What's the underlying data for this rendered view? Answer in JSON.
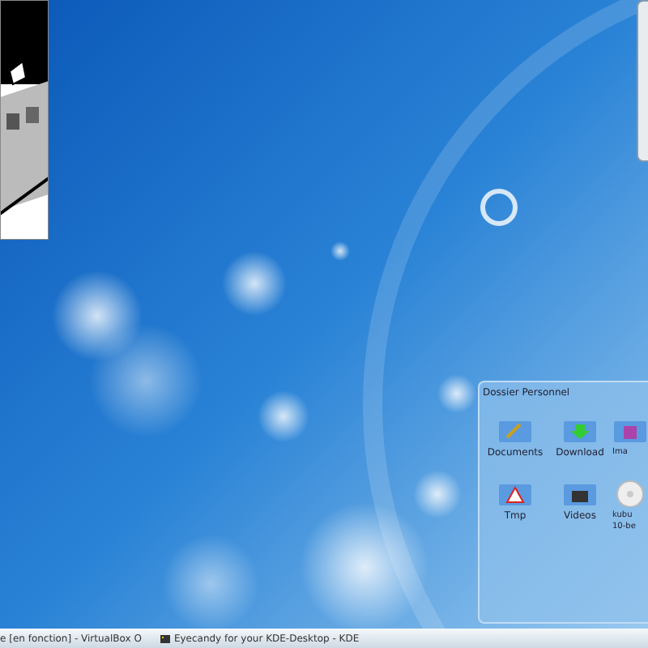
{
  "folder_view": {
    "title": "Dossier Personnel",
    "items": [
      {
        "label": "Documents",
        "kind": "documents"
      },
      {
        "label": "Download",
        "kind": "download"
      },
      {
        "label": "Ima",
        "kind": "images"
      },
      {
        "label": "Tmp",
        "kind": "warning"
      },
      {
        "label": "Videos",
        "kind": "videos"
      },
      {
        "label": "kubu\n10-be",
        "kind": "disc"
      }
    ]
  },
  "taskbar": {
    "tasks": [
      {
        "label": "e [en fonction] - VirtualBox O",
        "icon": false
      },
      {
        "label": "Eyecandy for your KDE-Desktop - KDE",
        "icon": true
      }
    ]
  }
}
